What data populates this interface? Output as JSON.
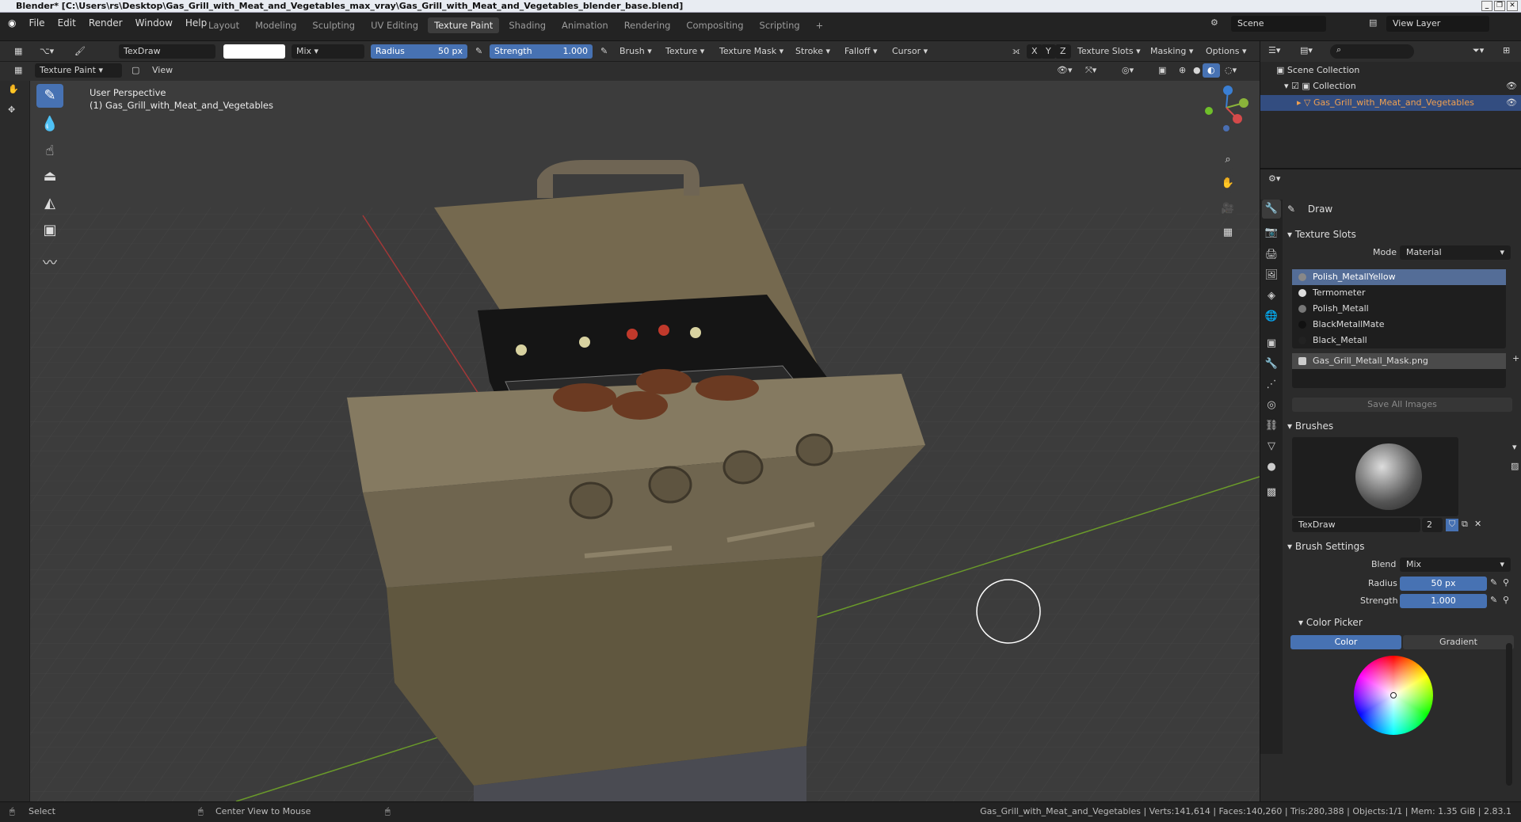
{
  "window": {
    "title": "Blender* [C:\\Users\\rs\\Desktop\\Gas_Grill_with_Meat_and_Vegetables_max_vray\\Gas_Grill_with_Meat_and_Vegetables_blender_base.blend]"
  },
  "menu": [
    "File",
    "Edit",
    "Render",
    "Window",
    "Help"
  ],
  "workspaces": [
    "Layout",
    "Modeling",
    "Sculpting",
    "UV Editing",
    "Texture Paint",
    "Shading",
    "Animation",
    "Rendering",
    "Compositing",
    "Scripting"
  ],
  "active_workspace": "Texture Paint",
  "scene": {
    "name": "Scene",
    "view_layer": "View Layer"
  },
  "toolheader": {
    "brush_name": "TexDraw",
    "blend": "Mix",
    "radius_label": "Radius",
    "radius_value": "50 px",
    "strength_label": "Strength",
    "strength_value": "1.000",
    "menus": [
      "Brush",
      "Texture",
      "Texture Mask",
      "Stroke",
      "Falloff",
      "Cursor"
    ],
    "axes": [
      "X",
      "Y",
      "Z"
    ],
    "right_menus": [
      "Texture Slots",
      "Masking",
      "Options"
    ]
  },
  "header2": {
    "mode": "Texture Paint",
    "view": "View"
  },
  "viewport": {
    "perspective": "User Perspective",
    "object": "(1) Gas_Grill_with_Meat_and_Vegetables"
  },
  "outliner": {
    "root": "Scene Collection",
    "collection": "Collection",
    "object": "Gas_Grill_with_Meat_and_Vegetables"
  },
  "properties": {
    "tool": "Draw",
    "texture_slots_title": "Texture Slots",
    "mode_label": "Mode",
    "mode_value": "Material",
    "slots": [
      "Polish_MetallYellow",
      "Termometer",
      "Polish_Metall",
      "BlackMetallMate",
      "Black_Metall"
    ],
    "image": "Gas_Grill_Metall_Mask.png",
    "save_all": "Save All Images",
    "brushes_title": "Brushes",
    "brush_name": "TexDraw",
    "brush_users": "2",
    "brush_settings_title": "Brush Settings",
    "blend_label": "Blend",
    "blend_value": "Mix",
    "radius_label": "Radius",
    "radius_value": "50 px",
    "strength_label": "Strength",
    "strength_value": "1.000",
    "color_picker_title": "Color Picker",
    "color_tab": "Color",
    "gradient_tab": "Gradient"
  },
  "statusbar": {
    "select": "Select",
    "center": "Center View to Mouse",
    "stats": "Gas_Grill_with_Meat_and_Vegetables | Verts:141,614 | Faces:140,260 | Tris:280,388 | Objects:1/1 | Mem: 1.35 GiB | 2.83.1"
  },
  "colors": {
    "accent": "#4772b3",
    "selected_slot": "#546d97"
  }
}
